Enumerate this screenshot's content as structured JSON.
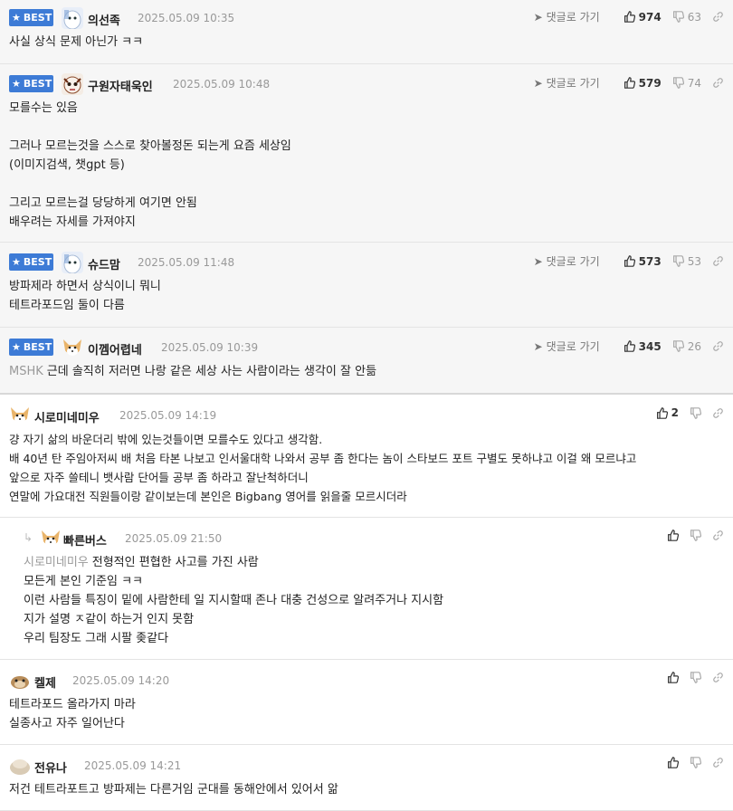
{
  "labels": {
    "best": "BEST",
    "reply_link": "댓글로 가기"
  },
  "comments": [
    {
      "nick": "의선족",
      "date": "2025.05.09 10:35",
      "up": "974",
      "down": "63",
      "lines": [
        "사실 상식 문제 아닌가 ㅋㅋ"
      ]
    },
    {
      "nick": "구원자태욱인",
      "date": "2025.05.09 10:48",
      "up": "579",
      "down": "74",
      "lines": [
        "모를수는 있음",
        "",
        "그러나 모르는것을 스스로 찾아볼정돈 되는게 요즘 세상임",
        "(이미지검색, 챗gpt 등)",
        "",
        "그리고 모르는걸 당당하게 여기면 안됨",
        "배우려는 자세를 가져야지"
      ]
    },
    {
      "nick": "슈드맘",
      "date": "2025.05.09 11:48",
      "up": "573",
      "down": "53",
      "lines": [
        "방파제라 하면서 상식이니 뭐니",
        "테트라포드임 둘이 다름"
      ]
    },
    {
      "nick": "이껨어렵네",
      "date": "2025.05.09 10:39",
      "up": "345",
      "down": "26",
      "mention": "MSHK",
      "lines": [
        "근데 솔직히 저러면 나랑 같은 세상 사는 사람이라는 생각이 잘 안듦"
      ]
    },
    {
      "nick": "시로미네미우",
      "date": "2025.05.09 14:19",
      "up": "2",
      "down": "",
      "lines": [
        "걍 자기 삶의 바운더리 밖에 있는것들이면 모를수도 있다고 생각함.",
        "배 40년 탄 주임아저씨 배 처음 타본 나보고 인서울대학 나와서 공부 좀 한다는 놈이 스타보드 포트 구별도 못하냐고 이걸 왜 모르냐고",
        "앞으로 자주 쓸테니 뱃사람 단어들 공부 좀 하라고 잘난척하더니",
        "연말에 가요대전 직원들이랑 같이보는데 본인은 Bigbang 영어를 읽을줄 모르시더라"
      ]
    },
    {
      "nick": "빠른버스",
      "date": "2025.05.09 21:50",
      "up": "",
      "down": "",
      "mention": "시로미네미우",
      "lines": [
        "전형적인 편협한 사고를 가진 사람",
        "모든게 본인 기준임 ㅋㅋ",
        "이런 사람들 특징이 밑에 사람한테 일 지시할때 존나 대충 건성으로 알려주거나 지시함",
        "지가 설명 ㅈ같이 하는거 인지 못함",
        "우리 팀장도 그래 시팔 좆같다"
      ]
    },
    {
      "nick": "켈제",
      "date": "2025.05.09 14:20",
      "up": "",
      "down": "",
      "lines": [
        "테트라포드 올라가지 마라",
        "실종사고 자주 일어난다"
      ]
    },
    {
      "nick": "전유나",
      "date": "2025.05.09 14:21",
      "up": "",
      "down": "",
      "lines": [
        "저건 테트라포트고 방파제는 다른거임 군대를 동해안에서 있어서 앎"
      ]
    }
  ]
}
